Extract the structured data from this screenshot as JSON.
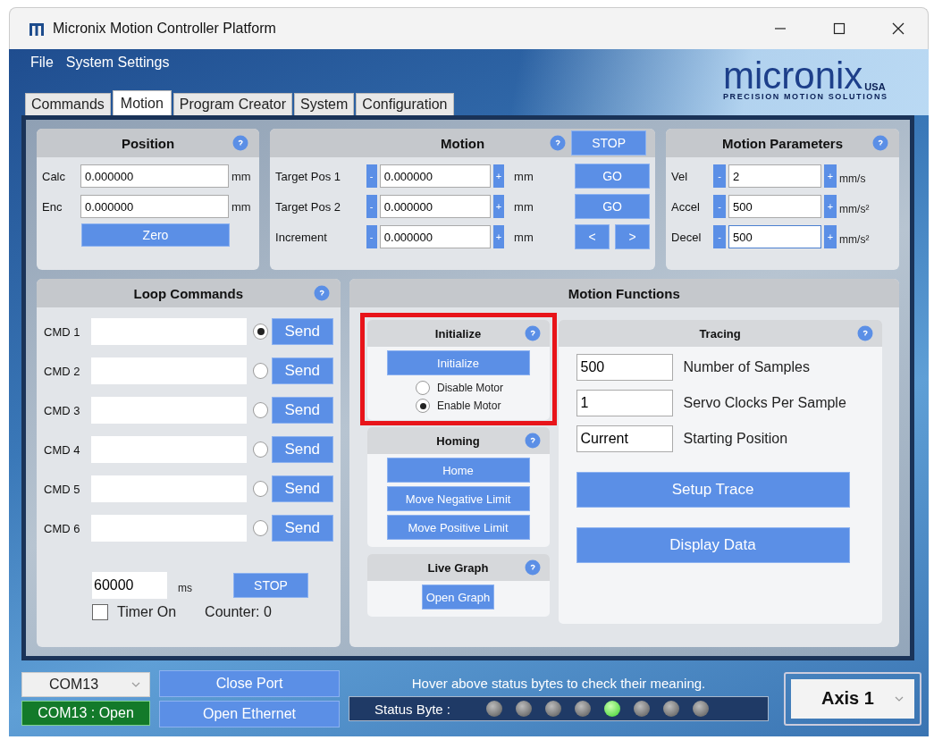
{
  "window": {
    "title": "Micronix Motion Controller Platform"
  },
  "menu": [
    "File",
    "System Settings"
  ],
  "logo": {
    "name": "micronix",
    "suffix": "USA",
    "tagline": "PRECISION MOTION SOLUTIONS"
  },
  "tabs": [
    {
      "label": "Commands",
      "selected": false
    },
    {
      "label": "Motion",
      "selected": true
    },
    {
      "label": "Program Creator",
      "selected": false
    },
    {
      "label": "System",
      "selected": false
    },
    {
      "label": "Configuration",
      "selected": false
    }
  ],
  "position": {
    "title": "Position",
    "rows": [
      {
        "label": "Calc",
        "value": "0.000000",
        "unit": "mm"
      },
      {
        "label": "Enc",
        "value": "0.000000",
        "unit": "mm"
      }
    ],
    "button": "Zero"
  },
  "motion": {
    "title": "Motion",
    "stop": "STOP",
    "rows": [
      {
        "label": "Target Pos 1",
        "minus": "-",
        "value": "0.000000",
        "plus": "+",
        "unit": "mm",
        "actions": [
          "GO"
        ]
      },
      {
        "label": "Target Pos 2",
        "minus": "-",
        "value": "0.000000",
        "plus": "+",
        "unit": "mm",
        "actions": [
          "GO"
        ]
      },
      {
        "label": "Increment",
        "minus": "-",
        "value": "0.000000",
        "plus": "+",
        "unit": "mm",
        "actions": [
          "<",
          ">"
        ]
      }
    ]
  },
  "motion_parameters": {
    "title": "Motion Parameters",
    "rows": [
      {
        "label": "Vel",
        "minus": "-",
        "value": "2",
        "plus": "+",
        "unit": "mm/s",
        "focused": false
      },
      {
        "label": "Accel",
        "minus": "-",
        "value": "500",
        "plus": "+",
        "unit": "mm/s²",
        "focused": false
      },
      {
        "label": "Decel",
        "minus": "-",
        "value": "500",
        "plus": "+",
        "unit": "mm/s²",
        "focused": true
      }
    ]
  },
  "loop_commands": {
    "title": "Loop Commands",
    "rows": [
      {
        "label": "CMD 1",
        "selected": true,
        "button": "Send"
      },
      {
        "label": "CMD 2",
        "selected": false,
        "button": "Send"
      },
      {
        "label": "CMD 3",
        "selected": false,
        "button": "Send"
      },
      {
        "label": "CMD 4",
        "selected": false,
        "button": "Send"
      },
      {
        "label": "CMD 5",
        "selected": false,
        "button": "Send"
      },
      {
        "label": "CMD 6",
        "selected": false,
        "button": "Send"
      }
    ],
    "timer": {
      "value": "60000",
      "unit": "ms",
      "stop": "STOP",
      "checkbox_label": "Timer On",
      "checked": false,
      "counter": "Counter: 0"
    }
  },
  "motion_functions": {
    "title": "Motion Functions",
    "initialize": {
      "title": "Initialize",
      "button": "Initialize",
      "highlighted": true,
      "options": [
        {
          "label": "Disable Motor",
          "selected": false
        },
        {
          "label": "Enable Motor",
          "selected": true
        }
      ]
    },
    "homing": {
      "title": "Homing",
      "buttons": [
        "Home",
        "Move Negative Limit",
        "Move Positive Limit"
      ]
    },
    "live_graph": {
      "title": "Live Graph",
      "button": "Open Graph"
    },
    "tracing": {
      "title": "Tracing",
      "fields": [
        {
          "value": "500",
          "label": "Number of Samples"
        },
        {
          "value": "1",
          "label": "Servo Clocks Per Sample"
        },
        {
          "value": "Current",
          "label": "Starting Position"
        }
      ],
      "buttons": [
        "Setup Trace",
        "Display Data"
      ]
    }
  },
  "status_bar": {
    "port": "COM13",
    "port_status": "COM13 : Open",
    "buttons": [
      "Close Port",
      "Open Ethernet"
    ],
    "hint": "Hover above status bytes to check their meaning.",
    "status_label": "Status Byte :",
    "leds": [
      {
        "on": false
      },
      {
        "on": false
      },
      {
        "on": false
      },
      {
        "on": false
      },
      {
        "on": true
      },
      {
        "on": false
      },
      {
        "on": false
      },
      {
        "on": false
      }
    ],
    "axis": "Axis 1"
  }
}
